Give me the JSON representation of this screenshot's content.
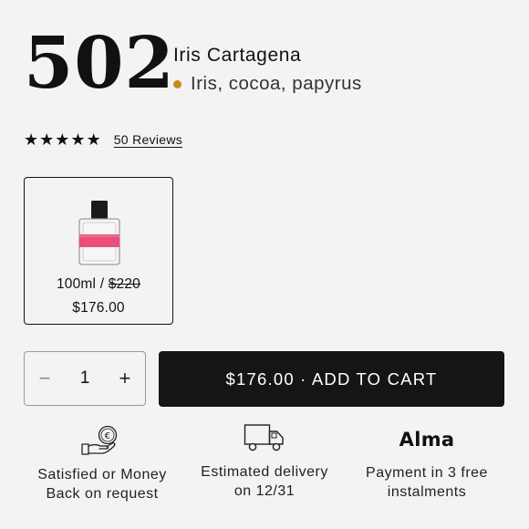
{
  "product": {
    "number": "502",
    "name": "Iris Cartagena",
    "notes": "Iris, cocoa, papyrus",
    "notes_dot_color": "#c98a1a"
  },
  "rating": {
    "stars": 5,
    "reviews_label": "50 Reviews"
  },
  "variant": {
    "size": "100ml /",
    "original_price": "$220",
    "price": "$176.00",
    "label_color": "#e8507a",
    "icon": "perfume-bottle-icon"
  },
  "quantity": {
    "value": "1",
    "minus_label": "−",
    "plus_label": "+"
  },
  "cart": {
    "label": "$176.00 · ADD TO CART"
  },
  "features": [
    {
      "icon": "hand-euro-coin-icon",
      "label": "Satisfied or Money Back on request"
    },
    {
      "icon": "delivery-truck-icon",
      "label": "Estimated delivery on 12/31"
    },
    {
      "icon": "alma-logo",
      "logo_text": "Alma",
      "label": "Payment in 3 free instalments"
    }
  ]
}
